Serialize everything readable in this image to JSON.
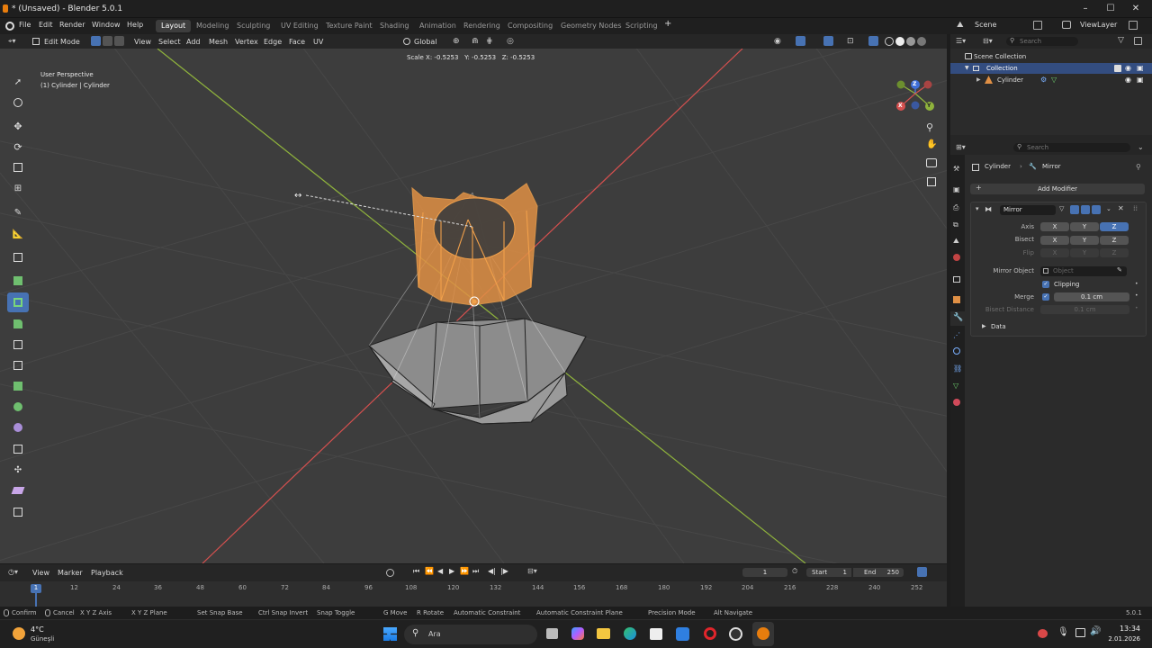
{
  "window": {
    "title": "* (Unsaved) - Blender 5.0.1"
  },
  "menu": [
    "File",
    "Edit",
    "Render",
    "Window",
    "Help"
  ],
  "workspaces": [
    "Layout",
    "Modeling",
    "Sculpting",
    "UV Editing",
    "Texture Paint",
    "Shading",
    "Animation",
    "Rendering",
    "Compositing",
    "Geometry Nodes",
    "Scripting"
  ],
  "scene": {
    "label": "Scene",
    "view_layer": "ViewLayer"
  },
  "viewport_header": {
    "mode": "Edit Mode",
    "menus": [
      "View",
      "Select",
      "Add",
      "Mesh",
      "Vertex",
      "Edge",
      "Face",
      "UV"
    ],
    "orientation": "Global"
  },
  "viewport": {
    "perspective": "User Perspective",
    "object": "(1) Cylinder | Cylinder",
    "transform_info": "Scale X: -0.5253   Y: -0.5253   Z: -0.5253"
  },
  "gizmo": {
    "x": "X",
    "y": "Y",
    "z": "Z"
  },
  "outliner": {
    "search_placeholder": "Search",
    "collection_root": "Scene Collection",
    "collection": "Collection",
    "object": "Cylinder"
  },
  "properties": {
    "search_placeholder": "Search",
    "breadcrumb_object": "Cylinder",
    "breadcrumb_modifier": "Mirror",
    "add_modifier": "Add Modifier",
    "modifier_name": "Mirror",
    "axis_label": "Axis",
    "bisect_label": "Bisect",
    "flip_label": "Flip",
    "x": "X",
    "y": "Y",
    "z": "Z",
    "mirror_object_label": "Mirror Object",
    "mirror_object_placeholder": "Object",
    "clipping_label": "Clipping",
    "merge_label": "Merge",
    "merge_value": "0.1 cm",
    "bisect_distance_label": "Bisect Distance",
    "bisect_distance_value": "0.1 cm",
    "data_label": "Data"
  },
  "timeline": {
    "menus": [
      "View",
      "Marker",
      "Playback"
    ],
    "current_frame": "1",
    "start_label": "Start",
    "start": "1",
    "end_label": "End",
    "end": "250",
    "ruler": [
      "1",
      "12",
      "24",
      "36",
      "48",
      "60",
      "72",
      "84",
      "96",
      "108",
      "120",
      "132",
      "144",
      "156",
      "168",
      "180",
      "192",
      "204",
      "216",
      "228",
      "240",
      "252"
    ]
  },
  "status": {
    "items": [
      "Confirm",
      "Cancel",
      "X Y Z Axis",
      "X Y Z Plane",
      "Set Snap Base",
      "Ctrl Snap Invert",
      "Snap Toggle",
      "G Move",
      "R Rotate",
      "Automatic Constraint",
      "Automatic Constraint Plane",
      "Precision Mode",
      "Alt Navigate"
    ],
    "version": "5.0.1"
  },
  "taskbar": {
    "weather_temp": "4°C",
    "weather_text": "Güneşli",
    "search": "Ara",
    "time": "13:34",
    "date": "2.01.2026"
  },
  "colors": {
    "accent": "#4772b3",
    "selection": "#f0a04b",
    "x_axis": "#d6504f",
    "y_axis": "#8fb33c",
    "viewport_bg": "#3d3d3d"
  }
}
